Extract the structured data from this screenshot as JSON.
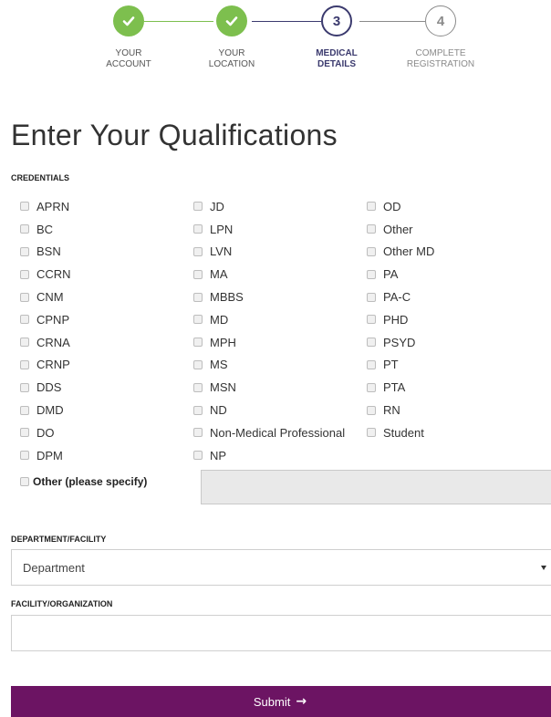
{
  "stepper": {
    "steps": [
      {
        "number": "",
        "line1": "YOUR",
        "line2": "ACCOUNT",
        "state": "done",
        "icon": "check-icon"
      },
      {
        "number": "",
        "line1": "YOUR",
        "line2": "LOCATION",
        "state": "done",
        "icon": "check-icon"
      },
      {
        "number": "3",
        "line1": "MEDICAL",
        "line2": "DETAILS",
        "state": "active"
      },
      {
        "number": "4",
        "line1": "COMPLETE",
        "line2": "REGISTRATION",
        "state": "todo"
      }
    ],
    "colors": {
      "done": "#7dbf4e",
      "active": "#3b3a6e",
      "todo": "#8a8a8a"
    }
  },
  "title": "Enter Your Qualifications",
  "credentials": {
    "label": "CREDENTIALS",
    "columns": [
      [
        "APRN",
        "BC",
        "BSN",
        "CCRN",
        "CNM",
        "CPNP",
        "CRNA",
        "CRNP",
        "DDS",
        "DMD",
        "DO",
        "DPM"
      ],
      [
        "JD",
        "LPN",
        "LVN",
        "MA",
        "MBBS",
        "MD",
        "MPH",
        "MS",
        "MSN",
        "ND",
        "Non-Medical Professional",
        "NP"
      ],
      [
        "OD",
        "Other",
        "Other MD",
        "PA",
        "PA-C",
        "PHD",
        "PSYD",
        "PT",
        "PTA",
        "RN",
        "Student"
      ]
    ],
    "other_label": "Other (please specify)",
    "other_value": ""
  },
  "department": {
    "label": "DEPARTMENT/FACILITY",
    "selected": "Department"
  },
  "facility": {
    "label": "FACILITY/ORGANIZATION",
    "value": ""
  },
  "submit": {
    "label": "Submit",
    "arrow": "→",
    "color": "#6c1463"
  }
}
